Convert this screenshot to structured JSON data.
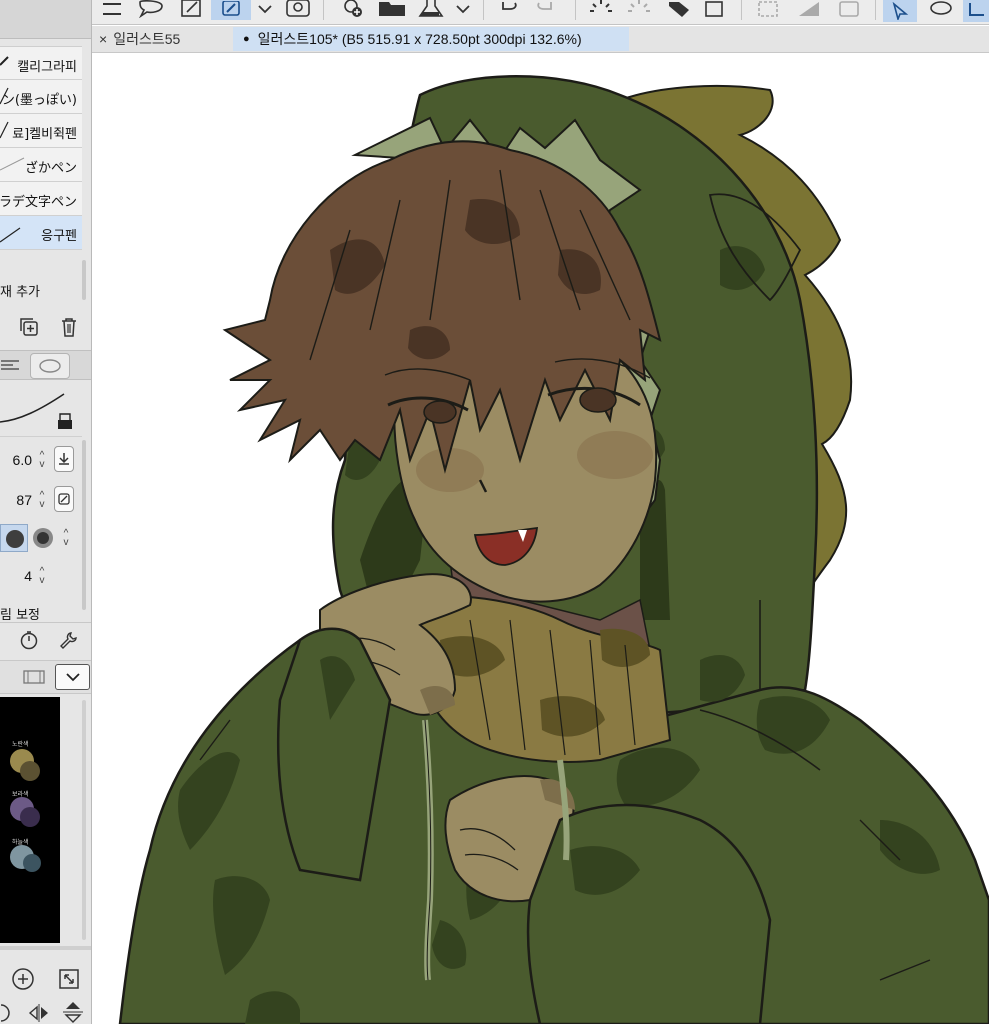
{
  "toolbar": {
    "icons": [
      "menu-icon",
      "speech-bubble-icon",
      "edit-icon",
      "pen-tool-icon",
      "chevron-down-icon",
      "spiral-icon",
      "add-layer-icon",
      "folder-icon",
      "flask-icon",
      "chevron-down-icon",
      "undo-icon",
      "redo-icon",
      "spinner-icon",
      "dotted-spinner-icon",
      "tag-icon",
      "crop-icon",
      "deselect-icon",
      "gradient-icon",
      "layer-icon",
      "select-icon",
      "lasso-icon"
    ]
  },
  "tabs": [
    {
      "label": "일러스트55",
      "active": false,
      "prefix": "×"
    },
    {
      "label": "일러스트105* (B5 515.91 x 728.50pt 300dpi 132.6%)",
      "active": true,
      "prefix": "●"
    }
  ],
  "brush_list": {
    "items": [
      {
        "label": "캘리그라피",
        "selected": false
      },
      {
        "label": "ン(墨っぽい)",
        "selected": false
      },
      {
        "label": "료]켈비쥑펜",
        "selected": false
      },
      {
        "label": "ざかペン",
        "selected": false
      },
      {
        "label": "ラデ文字ペン",
        "selected": false
      },
      {
        "label": "응구펜",
        "selected": true
      }
    ],
    "add_label": "재 추가"
  },
  "tool_property": {
    "size_value": "6.0",
    "opacity_value": "87",
    "stabilization_value": "4",
    "correction_label": "림 보정"
  },
  "swatches": [
    {
      "label": "노란색",
      "colors": [
        "#9a8a4e",
        "#5b5132"
      ]
    },
    {
      "label": "보라색",
      "colors": [
        "#6c5a86",
        "#3a2d4d"
      ]
    },
    {
      "label": "하늘색",
      "colors": [
        "#7f96a0",
        "#3c5460"
      ]
    }
  ],
  "colors": {
    "hoodie": "#4a5b2e",
    "hoodie_shadow": "#34431f",
    "hoodie_spikes": "#97a47a",
    "hood_horns": "#7b7433",
    "hair": "#6b4e38",
    "hair_shadow": "#4a3425",
    "skin": "#9b8c63",
    "skin_shadow": "#7d6e4b",
    "blush": "#8c7551",
    "neck": "#6b5148",
    "scarf": "#8a7a43",
    "scarf_shadow": "#5e5325",
    "mouth": "#8a2f26",
    "line": "#1c1c17",
    "selection_blue": "#cfe0f3"
  }
}
